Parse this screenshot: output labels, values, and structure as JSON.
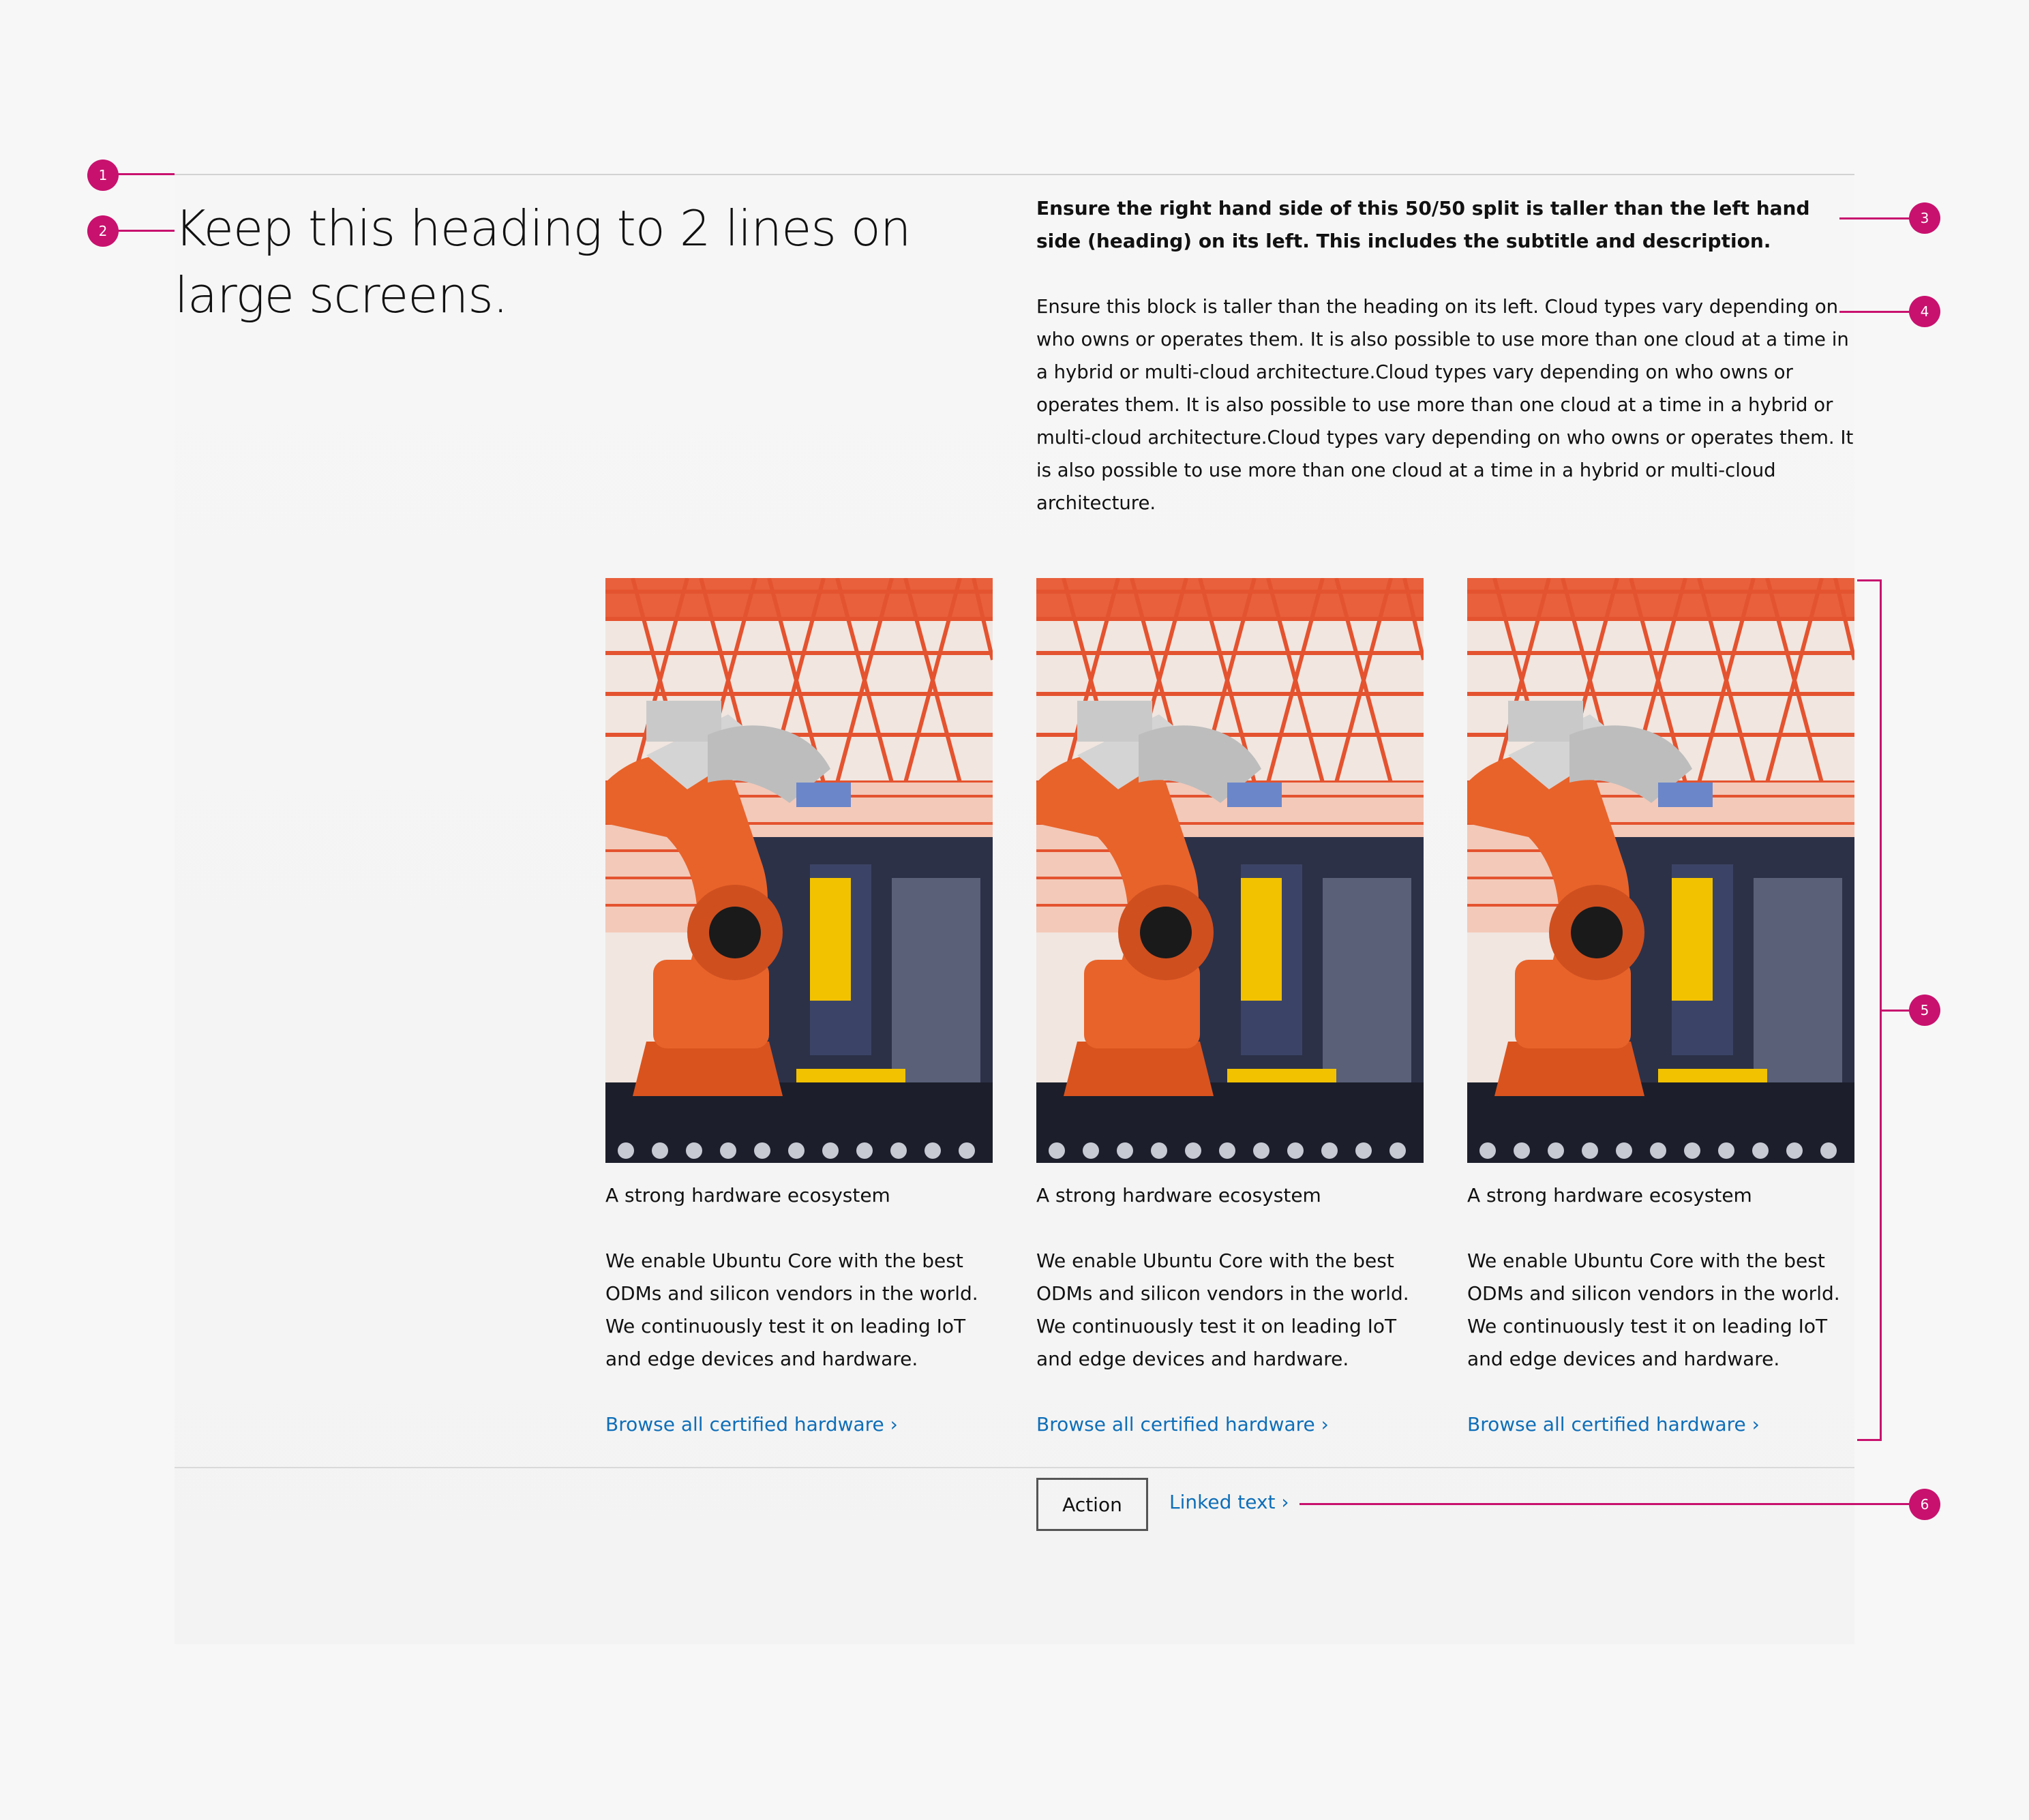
{
  "main": {
    "heading": "Keep this heading to 2 lines on large screens.",
    "subtitle": "Ensure the right hand side of this 50/50 split is taller than the left hand side (heading) on its left. This includes the subtitle and description.",
    "description": "Ensure this block is taller than the heading on its left. Cloud types vary depending on who owns or operates them. It is also possible to use more than one cloud at a time in a hybrid or multi-cloud architecture.Cloud types vary depending on who owns or operates them. It is also possible to use more than one cloud at a time in a hybrid or multi-cloud architecture.Cloud types vary depending on who owns or operates them. It is also possible to use more than one cloud at a time in a hybrid or multi-cloud architecture."
  },
  "cards": [
    {
      "title": "A strong hardware ecosystem",
      "description": "We enable Ubuntu Core with the best ODMs and silicon vendors in the world. We continuously test it on leading IoT and edge devices and hardware.",
      "link": "Browse all certified hardware ›",
      "image_icon": "industrial-robot-arm-image"
    },
    {
      "title": "A strong hardware ecosystem",
      "description": "We enable Ubuntu Core with the best ODMs and silicon vendors in the world. We continuously test it on leading IoT and edge devices and hardware.",
      "link": "Browse all certified hardware ›",
      "image_icon": "industrial-robot-arm-image"
    },
    {
      "title": "A strong hardware ecosystem",
      "description": "We enable Ubuntu Core with the best ODMs and silicon vendors in the world. We continuously test it on leading IoT and edge devices and hardware.",
      "link": "Browse all certified hardware ›",
      "image_icon": "industrial-robot-arm-image"
    }
  ],
  "cta": {
    "action_label": "Action",
    "linked_text": "Linked text ›"
  },
  "annotations": [
    "1",
    "2",
    "3",
    "4",
    "5",
    "6"
  ],
  "colors": {
    "annotation": "#c8116e",
    "link": "#0e6eb8",
    "text": "#111111",
    "background": "#f7f7f7"
  }
}
